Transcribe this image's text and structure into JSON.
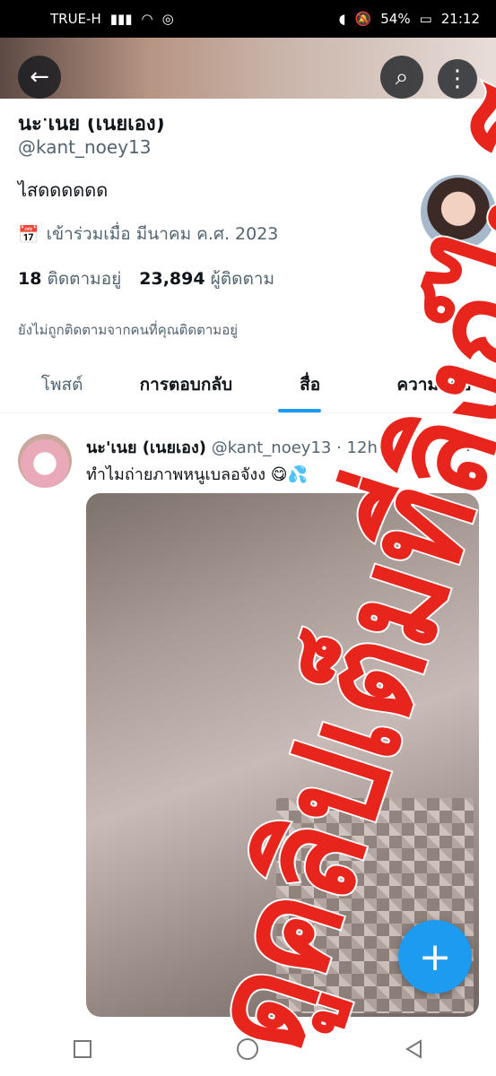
{
  "status_bar": {
    "carrier": "TRUE-H",
    "battery": "54%",
    "time": "21:12"
  },
  "profile": {
    "name_partial": "นะ'เนย (เนยเอง)",
    "handle": "@kant_noey13",
    "bio": "ไสดดดดดด",
    "joined": "เข้าร่วมเมื่อ มีนาคม ค.ศ. 2023",
    "following_count": "18",
    "following_label": "ติดตามอยู่",
    "followers_count": "23,894",
    "followers_label": "ผู้ติดตาม",
    "not_followed_note": "ยังไม่ถูกติดตามจากคนที่คุณติดตามอยู่"
  },
  "tabs": [
    "โพสต์",
    "การตอบกลับ",
    "สื่อ",
    "ความชอบ"
  ],
  "tweet": {
    "name": "นะ'เนย (เนยเอง)",
    "handle": "@kant_noey13",
    "time": "· 12h",
    "text": "ทำไมถ่ายภาพหนูเบลอจังง 😋💦"
  },
  "overlay": {
    "watermark_text": "ดูคลิปเต็มที่ลิงก์ไบโอ",
    "color": "#e8251c"
  },
  "colors": {
    "accent": "#1d9bf0",
    "text": "#0f1419",
    "secondary": "#536471"
  }
}
